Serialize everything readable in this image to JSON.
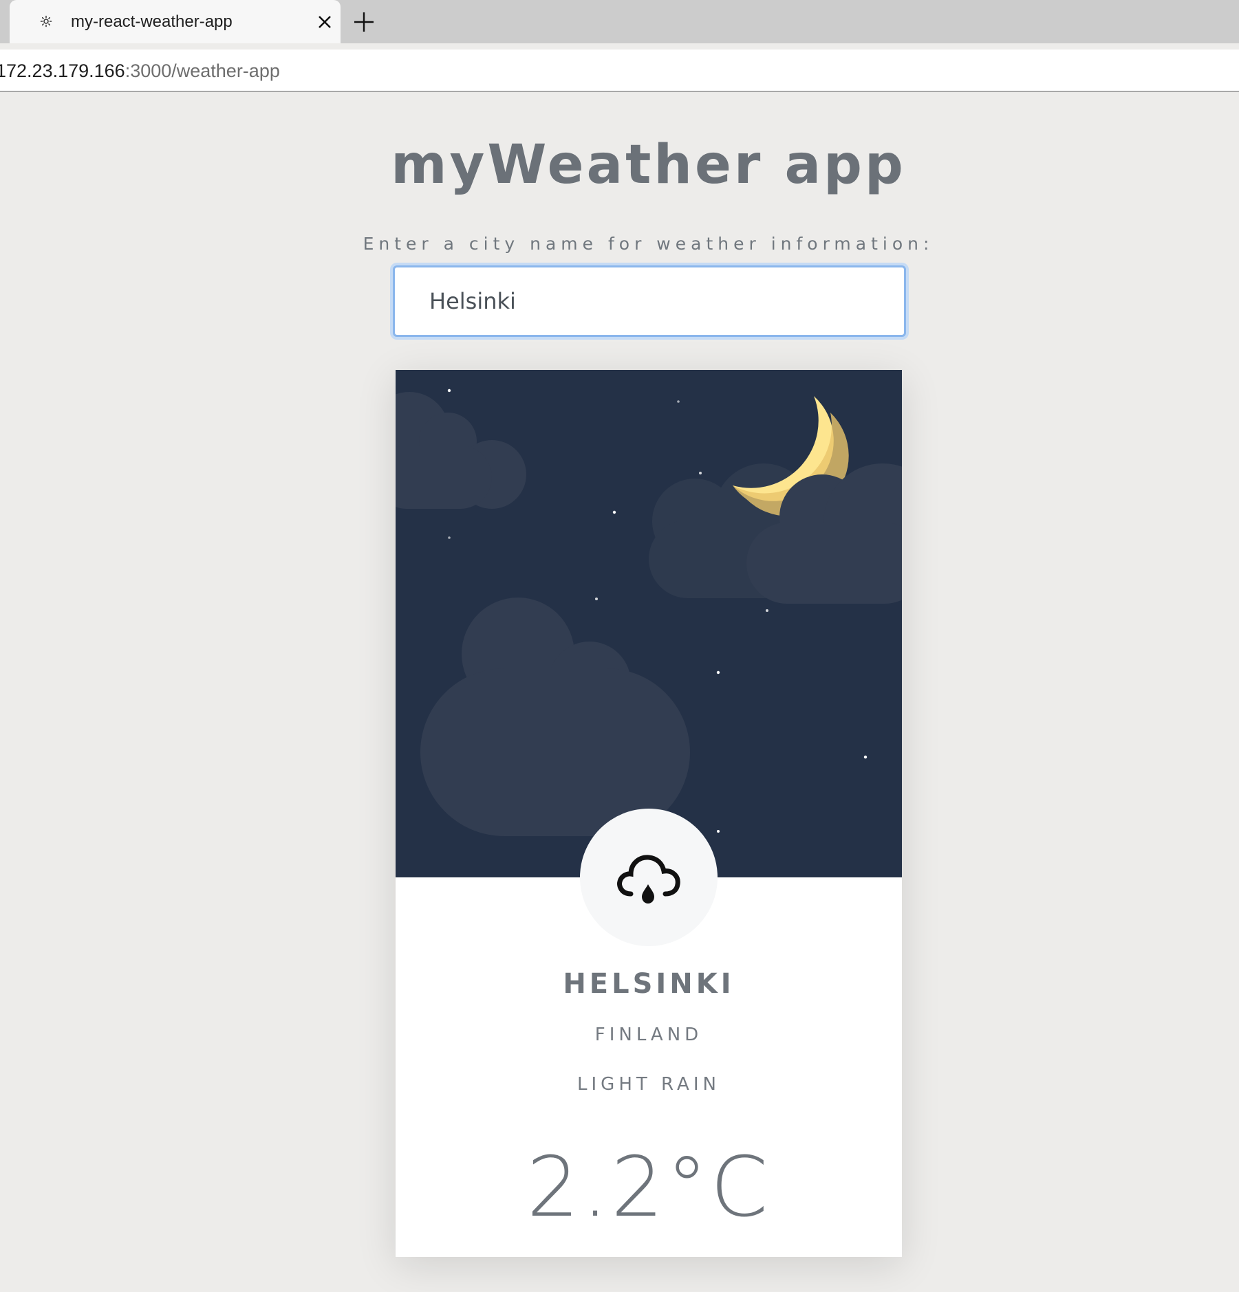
{
  "browser": {
    "tab_title": "my-react-weather-app",
    "favicon_icon": "sun-icon",
    "close_icon": "close-icon",
    "new_tab_icon": "plus-icon",
    "url_host": "172.23.179.166",
    "url_path": ":3000/weather-app"
  },
  "page": {
    "title": "myWeather app",
    "input_label": "Enter a city name for weather information:",
    "input_value": "Helsinki"
  },
  "weather": {
    "city": "HELSINKI",
    "country": "FINLAND",
    "condition": "LIGHT RAIN",
    "temperature": "2.2°C",
    "condition_icon": "cloud-rain-icon",
    "scene": "night-sky-moon-clouds"
  },
  "colors": {
    "sky": "#243147",
    "cloud": "#323d51",
    "moon": "#fde58f",
    "input_focus": "#8ab6ec",
    "text": "#6e747b"
  }
}
